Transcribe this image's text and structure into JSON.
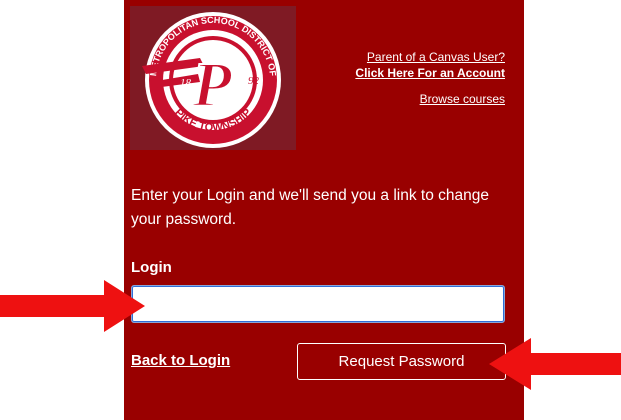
{
  "logo": {
    "top_text": "METROPOLITAN SCHOOL DISTRICT OF",
    "bottom_text": "PIKE TOWNSHIP",
    "year_left": "18",
    "year_right": "92",
    "letter": "P"
  },
  "links": {
    "parent_question": "Parent of a Canvas User?",
    "click_account": "Click Here For an Account",
    "browse": "Browse courses"
  },
  "form": {
    "intro": "Enter your Login and we'll send you a link to change your password.",
    "login_label": "Login",
    "login_value": "",
    "back_label": "Back to Login",
    "request_label": "Request Password"
  },
  "colors": {
    "panel": "#990000",
    "arrow": "#ee1111"
  }
}
